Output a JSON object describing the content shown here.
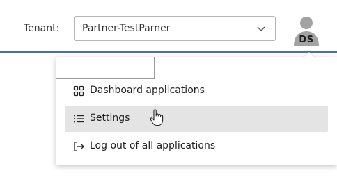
{
  "tenant": {
    "label": "Tenant:",
    "selected": "Partner-TestParner"
  },
  "user": {
    "initials": "DS"
  },
  "menu": {
    "items": [
      {
        "label": "Dashboard applications",
        "icon": "grid-icon"
      },
      {
        "label": "Settings",
        "icon": "list-icon"
      },
      {
        "label": "Log out of all applications",
        "icon": "logout-icon"
      }
    ],
    "hovered_index": 1
  },
  "colors": {
    "accent_rule": "#4a6fa5",
    "hover_background": "#e4e4e4"
  }
}
